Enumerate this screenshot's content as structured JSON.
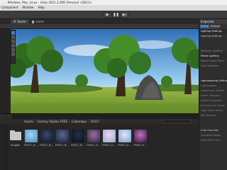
{
  "window": {
    "title": "... - Windows, Mac, Linux - Unity 2021.3.28f1 Personal <DX11>",
    "menu": [
      "Component",
      "Window",
      "Help"
    ]
  },
  "toolbar": {
    "play_icon": "play-icon",
    "pause_icon": "pause-icon",
    "step_icon": "step-icon"
  },
  "scene_tabs": [
    {
      "label": "Scene",
      "icon": "scene-icon",
      "active": true
    },
    {
      "label": "Game",
      "icon": "game-icon",
      "active": false
    }
  ],
  "inspector": {
    "title": "Inspector",
    "subtabs": [
      "Scene",
      "Environ"
    ],
    "rows": [
      {
        "text": "Lighting Settings",
        "kind": "head"
      },
      {
        "text": "Lighting Settings",
        "kind": "normal"
      },
      {
        "text": "",
        "kind": "normal"
      },
      {
        "text": "",
        "kind": "normal"
      },
      {
        "text": "Realtime Lighting",
        "kind": "dim"
      },
      {
        "text": "Mixed Lighting",
        "kind": "head"
      },
      {
        "text": "Baked Global Illum",
        "kind": "dim"
      },
      {
        "text": "Lighting Mode",
        "kind": "dim"
      },
      {
        "text": "",
        "kind": "normal"
      },
      {
        "text": "",
        "kind": "normal"
      },
      {
        "text": "Lightmapping Settings",
        "kind": "head"
      },
      {
        "text": "Lightmapper",
        "kind": "dim"
      },
      {
        "text": "Importance Sampl.",
        "kind": "dim"
      },
      {
        "text": "Direct Samples",
        "kind": "dim"
      },
      {
        "text": "Indirect Samples",
        "kind": "dim"
      },
      {
        "text": "Environment Samp.",
        "kind": "dim"
      },
      {
        "text": "Light Probe Samp.",
        "kind": "dim"
      },
      {
        "text": "Min Bounces",
        "kind": "dim"
      },
      {
        "text": "",
        "kind": "normal"
      },
      {
        "text": "",
        "kind": "normal"
      },
      {
        "text": "Auto Generate",
        "kind": "normal"
      },
      {
        "text": "Occupied Texels",
        "kind": "dim"
      },
      {
        "text": "Total Bake Time",
        "kind": "dim"
      }
    ]
  },
  "project": {
    "breadcrumb": [
      "Assets",
      "Fantasy Skybox FREE",
      "Cubemaps",
      "FS017"
    ],
    "assets": [
      {
        "label": "Images",
        "kind": "folder"
      },
      {
        "label": "FS017_D...",
        "colors": [
          "#9fd3f0",
          "#4a8fc8"
        ]
      },
      {
        "label": "FS017_N...",
        "colors": [
          "#3a4a6a",
          "#0e1426"
        ]
      },
      {
        "label": "FS017_N...",
        "colors": [
          "#586a8a",
          "#1b2440"
        ]
      },
      {
        "label": "FS017_N...",
        "colors": [
          "#243048",
          "#0a0f1e"
        ]
      },
      {
        "label": "FS017_S...",
        "colors": [
          "#9a6fa0",
          "#312848"
        ]
      },
      {
        "label": "FS017_S...",
        "colors": [
          "#f0d8e8",
          "#8fa8d8"
        ]
      },
      {
        "label": "FS017_S...",
        "colors": [
          "#dfe8f8",
          "#7a9ed0"
        ]
      },
      {
        "label": "FS017_S...",
        "colors": [
          "#c070b8",
          "#3a1848"
        ]
      }
    ]
  },
  "colors": {
    "accent": "#4a7fc1",
    "sky_top": "#3c7fc7",
    "sky_horizon": "#cfe6f7",
    "grass": "#7fa33a"
  }
}
